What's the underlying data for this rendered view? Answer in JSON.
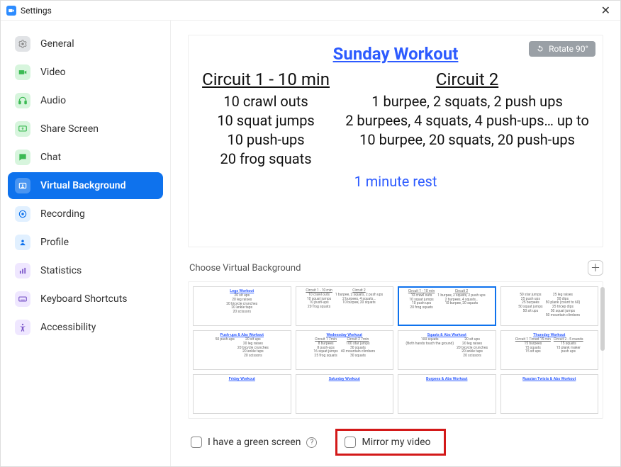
{
  "window": {
    "title": "Settings"
  },
  "sidebar": {
    "items": [
      {
        "label": "General"
      },
      {
        "label": "Video"
      },
      {
        "label": "Audio"
      },
      {
        "label": "Share Screen"
      },
      {
        "label": "Chat"
      },
      {
        "label": "Virtual Background"
      },
      {
        "label": "Recording"
      },
      {
        "label": "Profile"
      },
      {
        "label": "Statistics"
      },
      {
        "label": "Keyboard Shortcuts"
      },
      {
        "label": "Accessibility"
      }
    ],
    "active_index": 5
  },
  "preview": {
    "rotate_label": "Rotate 90°",
    "title": "Sunday Workout",
    "circuit1": {
      "heading": "Circuit 1 - 10 min",
      "lines": [
        "10 crawl outs",
        "10 squat jumps",
        "10 push-ups",
        "20 frog squats"
      ]
    },
    "circuit2": {
      "heading": "Circuit 2",
      "lines": [
        "1 burpee, 2 squats, 2 push ups",
        "2 burpees, 4 squats, 4 push-ups… up to",
        "10 burpee, 20 squats, 20 push-ups"
      ]
    },
    "rest": "1 minute rest"
  },
  "vbg": {
    "section_label": "Choose Virtual Background",
    "thumbs": [
      {
        "title": "Legs Workout",
        "col1": "20 sit ups\n20 leg raises\n20 bicycle crunches\n20 ankle taps\n20 scissors",
        "col2": ""
      },
      {
        "title": "",
        "c1h": "Circuit 1 - 10 min",
        "c1": "10 crawl outs\n10 squat jumps\n10 push-ups\n20 frog squats",
        "c2h": "Circuit 2",
        "c2": "1 burpee, 2 squats, 2 push ups\n2 burpees, 4 squats…\n10 burpee, 20 squats"
      },
      {
        "title": "",
        "c1h": "Circuit 1 - 10 min",
        "c1": "10 crawl outs\n10 squat jumps\n10 push-ups\n20 frog squats",
        "c2h": "Circuit 2",
        "c2": "1 burpee, 2 squats, 2 push ups\n2 burpees, 4 squats…\n10 burpee, 20 squats"
      },
      {
        "title": "",
        "c1h": "",
        "c1": "50 star jumps\n25 push ups\n25 burpees\n50 squat jumps\n50 sit ups",
        "c2h": "",
        "c2": "25 leg raises\n50 dips\n50 plank (count to 60)\n25 tricep dips\n50 squat jumps\n50 mountain climbers"
      },
      {
        "title": "Push-ups & Abs Workout",
        "col1": "50 push-ups",
        "col2": "20 sit ups\n20 leg raises\n20 bicycle crunches\n20 ankle taps\n20 scissors"
      },
      {
        "title": "Wednesday Workout",
        "c1h": "Circuit 1 7min",
        "c1": "8 burpees\n8 push-ups\n16 squat jumps\n25 frog squats",
        "c2h": "Circuit 2 7min",
        "c2": "100 star jumps\n30 squats\n40 mountain climbers\n30 squats"
      },
      {
        "title": "Squats & Abs Workout",
        "col1": "100 squats\n(Both hands touch the ground)",
        "col2": "20 sit ups\n20 leg raises\n20 bicycle crunches\n20 ankle taps\n20 scissors"
      },
      {
        "title": "Thursday Workout",
        "c1h": "Circuit 1 Timed 15 min",
        "c1": "15 burpees\n15 squats\n15 sit ups",
        "c2h": "Circuit 2 - 5 rounds",
        "c2": "15 squats\n15 plank maker\npush ups"
      },
      {
        "title": "Friday Workout",
        "col1": "",
        "col2": ""
      },
      {
        "title": "Saturday Workout",
        "col1": "",
        "col2": ""
      },
      {
        "title": "Burpees & Abs Workout",
        "col1": "",
        "col2": ""
      },
      {
        "title": "Russian Twists & Abs Workout",
        "col1": "",
        "col2": ""
      }
    ],
    "selected_index": 2
  },
  "footer": {
    "green_screen_label": "I have a green screen",
    "mirror_label": "Mirror my video"
  }
}
